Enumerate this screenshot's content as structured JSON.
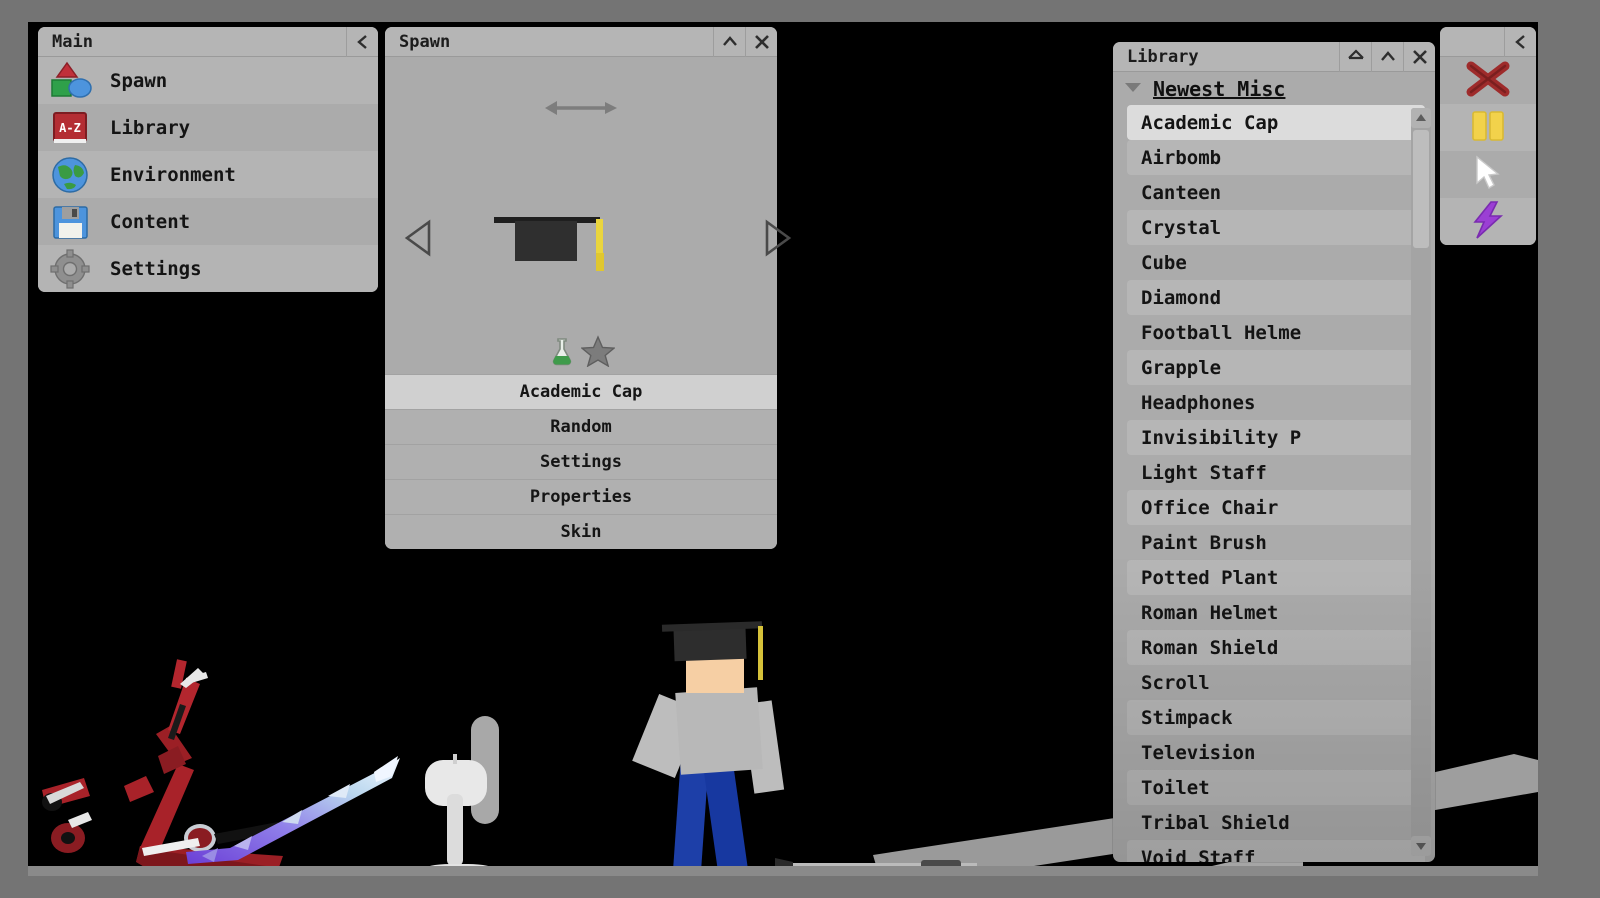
{
  "app": {
    "background_color": "#747474",
    "viewport_color": "#000000"
  },
  "main_panel": {
    "title": "Main",
    "collapse_icon": "chevron-left-icon",
    "items": [
      {
        "label": "Spawn",
        "icon": "shapes-icon"
      },
      {
        "label": "Library",
        "icon": "az-book-icon"
      },
      {
        "label": "Environment",
        "icon": "globe-icon"
      },
      {
        "label": "Content",
        "icon": "floppy-disk-icon"
      },
      {
        "label": "Settings",
        "icon": "gear-icon"
      }
    ]
  },
  "spawn_panel": {
    "title": "Spawn",
    "minimize_icon": "chevron-up-icon",
    "close_icon": "close-icon",
    "resize_icon": "horizontal-resize-arrow-icon",
    "prev_icon": "triangle-left-icon",
    "next_icon": "triangle-right-icon",
    "preview_item": "Academic Cap",
    "badges": [
      {
        "name": "flask-icon",
        "color": "#3f9b4b"
      },
      {
        "name": "star-icon",
        "color": "#7c7c7c"
      }
    ],
    "buttons": [
      {
        "label": "Academic Cap",
        "selected": true
      },
      {
        "label": "Random",
        "selected": false
      },
      {
        "label": "Settings",
        "selected": false
      },
      {
        "label": "Properties",
        "selected": false
      },
      {
        "label": "Skin",
        "selected": false
      }
    ]
  },
  "library_panel": {
    "title": "Library",
    "home_icon": "home-icon",
    "minimize_icon": "chevron-up-icon",
    "close_icon": "close-icon",
    "category": {
      "label": "Newest Misc",
      "expand_icon": "triangle-down-icon",
      "expanded": true
    },
    "items": [
      {
        "label": "Academic Cap",
        "selected": true
      },
      {
        "label": "Airbomb",
        "selected": false
      },
      {
        "label": "Canteen",
        "selected": false
      },
      {
        "label": "Crystal",
        "selected": false
      },
      {
        "label": "Cube",
        "selected": false
      },
      {
        "label": "Diamond",
        "selected": false
      },
      {
        "label": "Football Helme",
        "selected": false
      },
      {
        "label": "Grapple",
        "selected": false
      },
      {
        "label": "Headphones",
        "selected": false
      },
      {
        "label": "Invisibility P",
        "selected": false
      },
      {
        "label": "Light Staff",
        "selected": false
      },
      {
        "label": "Office Chair",
        "selected": false
      },
      {
        "label": "Paint Brush",
        "selected": false
      },
      {
        "label": "Potted Plant",
        "selected": false
      },
      {
        "label": "Roman Helmet",
        "selected": false
      },
      {
        "label": "Roman Shield",
        "selected": false
      },
      {
        "label": "Scroll",
        "selected": false
      },
      {
        "label": "Stimpack",
        "selected": false
      },
      {
        "label": "Television",
        "selected": false
      },
      {
        "label": "Toilet",
        "selected": false
      },
      {
        "label": "Tribal Shield",
        "selected": false
      },
      {
        "label": "Void Staff",
        "selected": false
      }
    ],
    "scrollbar": {
      "up_icon": "scroll-up-arrow-icon",
      "down_icon": "scroll-down-arrow-icon"
    }
  },
  "tool_panel": {
    "collapse_icon": "chevron-left-icon",
    "tools": [
      {
        "name": "delete-tool",
        "icon": "red-x-icon",
        "color": "#9e2b2b"
      },
      {
        "name": "pause-tool",
        "icon": "yellow-pause-icon",
        "color": "#f2d24b"
      },
      {
        "name": "select-tool",
        "icon": "white-cursor-icon",
        "color": "#ffffff"
      },
      {
        "name": "bolt-tool",
        "icon": "purple-lightning-icon",
        "color": "#9b3fd4"
      }
    ]
  },
  "scene": {
    "objects": [
      {
        "name": "scooter",
        "color": "#9b1f25"
      },
      {
        "name": "energy-sword",
        "color": "#8b63e0"
      },
      {
        "name": "desk-fan",
        "color": "#e0e0e0"
      },
      {
        "name": "ragdoll-character-with-academic-cap",
        "color": "#b8b8b8"
      },
      {
        "name": "tilted-plank",
        "color": "#9a9a9a"
      }
    ]
  }
}
